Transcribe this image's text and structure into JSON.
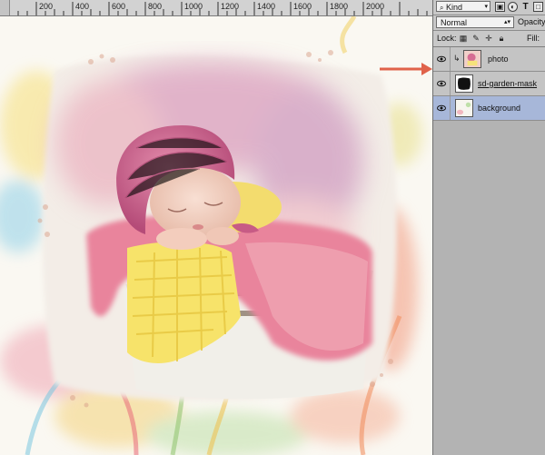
{
  "ruler": {
    "labels": [
      "200",
      "400",
      "600",
      "800",
      "1000",
      "1200",
      "1400",
      "1600",
      "1800",
      "2000"
    ]
  },
  "layers_panel": {
    "filter": {
      "kind_label": "Kind",
      "icons": [
        "image-filter-icon",
        "adjustment-filter-icon",
        "type-filter-icon",
        "shape-filter-icon"
      ]
    },
    "blend_mode": "Normal",
    "opacity_label": "Opacity:",
    "lock_label": "Lock:",
    "fill_label": "Fill:",
    "layers": [
      {
        "name": "photo",
        "visible": true,
        "clipped": true,
        "selected": false
      },
      {
        "name": "sd-garden-mask",
        "visible": true,
        "clipped": false,
        "selected": false
      },
      {
        "name": "background",
        "visible": true,
        "clipped": false,
        "selected": true
      }
    ]
  },
  "colors": {
    "selected_layer": "#a7b7d9",
    "annotation_arrow": "#e0624a"
  }
}
